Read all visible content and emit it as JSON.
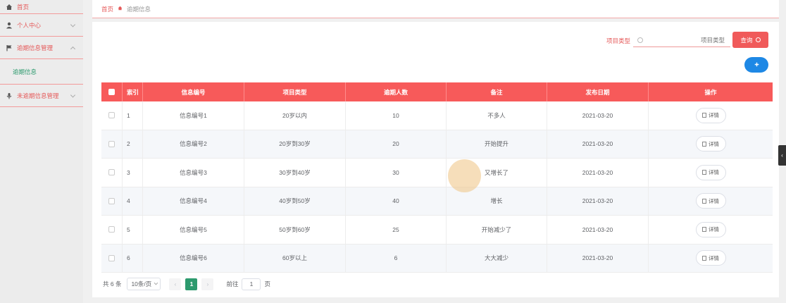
{
  "sidebar": {
    "items": [
      {
        "label": "首页"
      },
      {
        "label": "个人中心"
      },
      {
        "label": "逾期信息管理"
      },
      {
        "label": "未逾期信息管理"
      }
    ],
    "submenu": {
      "label": "逾期信息"
    }
  },
  "breadcrumb": {
    "home": "首页",
    "current": "逾期信息"
  },
  "search": {
    "label": "项目类型",
    "placeholder": "项目类型",
    "button": "查询"
  },
  "table": {
    "headers": [
      "索引",
      "信息编号",
      "项目类型",
      "逾期人数",
      "备注",
      "发布日期",
      "操作"
    ],
    "action_label": "详情",
    "rows": [
      {
        "index": "1",
        "code": "信息编号1",
        "type": "20岁以内",
        "count": "10",
        "note": "不多人",
        "date": "2021-03-20"
      },
      {
        "index": "2",
        "code": "信息编号2",
        "type": "20岁到30岁",
        "count": "20",
        "note": "开始提升",
        "date": "2021-03-20"
      },
      {
        "index": "3",
        "code": "信息编号3",
        "type": "30岁到40岁",
        "count": "30",
        "note": "又增长了",
        "date": "2021-03-20"
      },
      {
        "index": "4",
        "code": "信息编号4",
        "type": "40岁到50岁",
        "count": "40",
        "note": "增长",
        "date": "2021-03-20"
      },
      {
        "index": "5",
        "code": "信息编号5",
        "type": "50岁到60岁",
        "count": "25",
        "note": "开始减少了",
        "date": "2021-03-20"
      },
      {
        "index": "6",
        "code": "信息编号6",
        "type": "60岁以上",
        "count": "6",
        "note": "大大减少",
        "date": "2021-03-20"
      }
    ]
  },
  "pagination": {
    "total": "共 6 条",
    "page_size": "10条/页",
    "current_page": "1",
    "goto_label": "前往",
    "goto_value": "1",
    "page_suffix": "页"
  },
  "colors": {
    "accent": "#f75a5a",
    "active": "#2d9a6e",
    "add_button": "#1e88e5"
  }
}
